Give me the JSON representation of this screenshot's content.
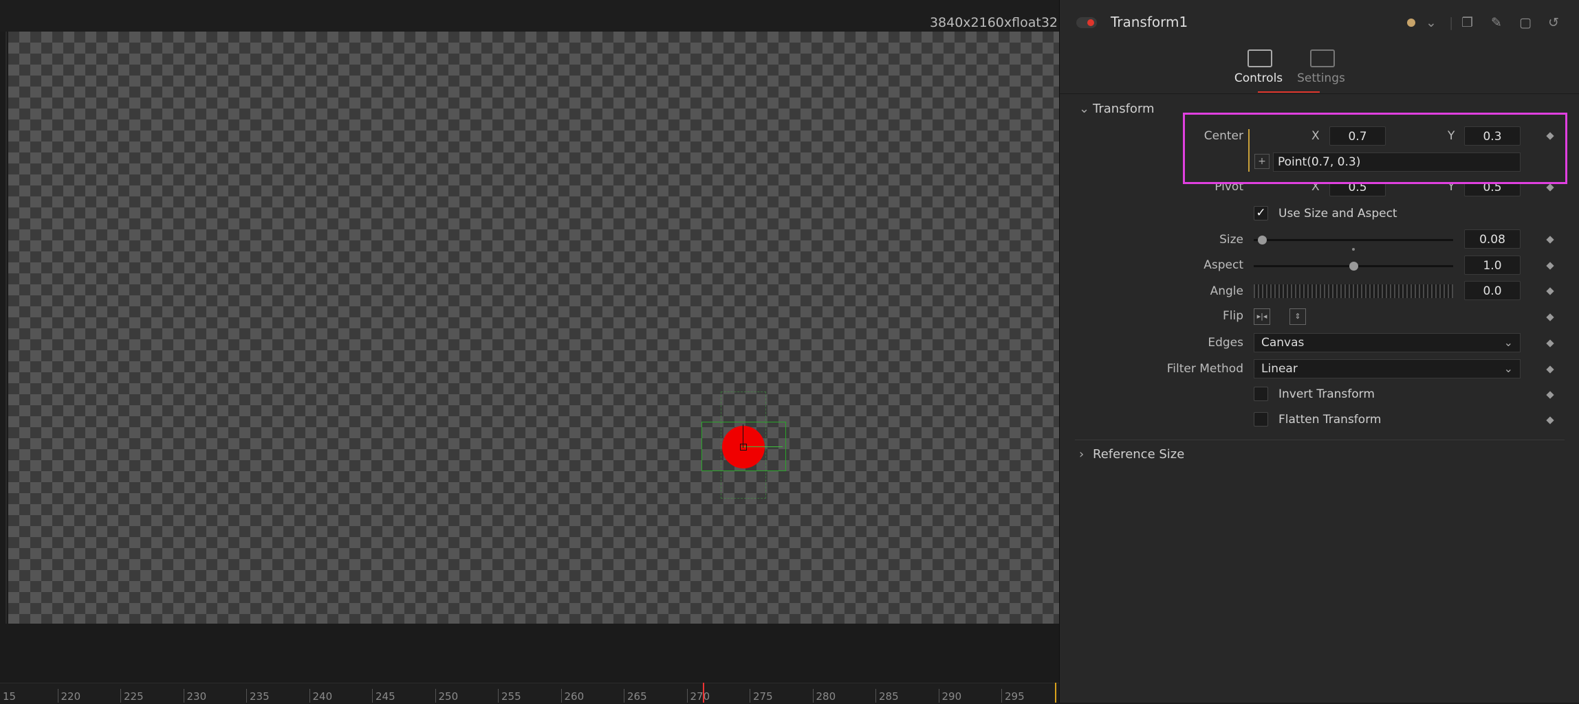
{
  "viewer": {
    "resolution_label": "3840x2160xfloat32"
  },
  "timeline": {
    "ticks": [
      "15",
      "220",
      "225",
      "230",
      "235",
      "240",
      "245",
      "250",
      "255",
      "260",
      "265",
      "270",
      "275",
      "280",
      "285",
      "290",
      "295"
    ]
  },
  "inspector": {
    "node_title": "Transform1",
    "tabs": [
      {
        "label": "Controls",
        "active": true
      },
      {
        "label": "Settings",
        "active": false
      }
    ],
    "section_transform": "Transform",
    "center": {
      "label": "Center",
      "x_label": "X",
      "x_value": "0.7",
      "y_label": "Y",
      "y_value": "0.3",
      "expression": "Point(0.7, 0.3)"
    },
    "pivot": {
      "label": "Pivot",
      "x_label": "X",
      "x_value": "0.5",
      "y_label": "Y",
      "y_value": "0.5"
    },
    "use_size_aspect": {
      "label": "Use Size and Aspect",
      "checked": true
    },
    "size": {
      "label": "Size",
      "value": "0.08",
      "fraction": 0.02
    },
    "aspect": {
      "label": "Aspect",
      "value": "1.0",
      "fraction": 0.5
    },
    "angle": {
      "label": "Angle",
      "value": "0.0"
    },
    "flip": {
      "label": "Flip"
    },
    "edges": {
      "label": "Edges",
      "value": "Canvas"
    },
    "filter_method": {
      "label": "Filter Method",
      "value": "Linear"
    },
    "invert_transform": {
      "label": "Invert Transform",
      "checked": false
    },
    "flatten_transform": {
      "label": "Flatten Transform",
      "checked": false
    },
    "section_reference": "Reference Size"
  },
  "colors": {
    "accent_red": "#e0362c",
    "highlight_magenta": "#e040e0",
    "keyframe_gold": "#c8a03a"
  }
}
